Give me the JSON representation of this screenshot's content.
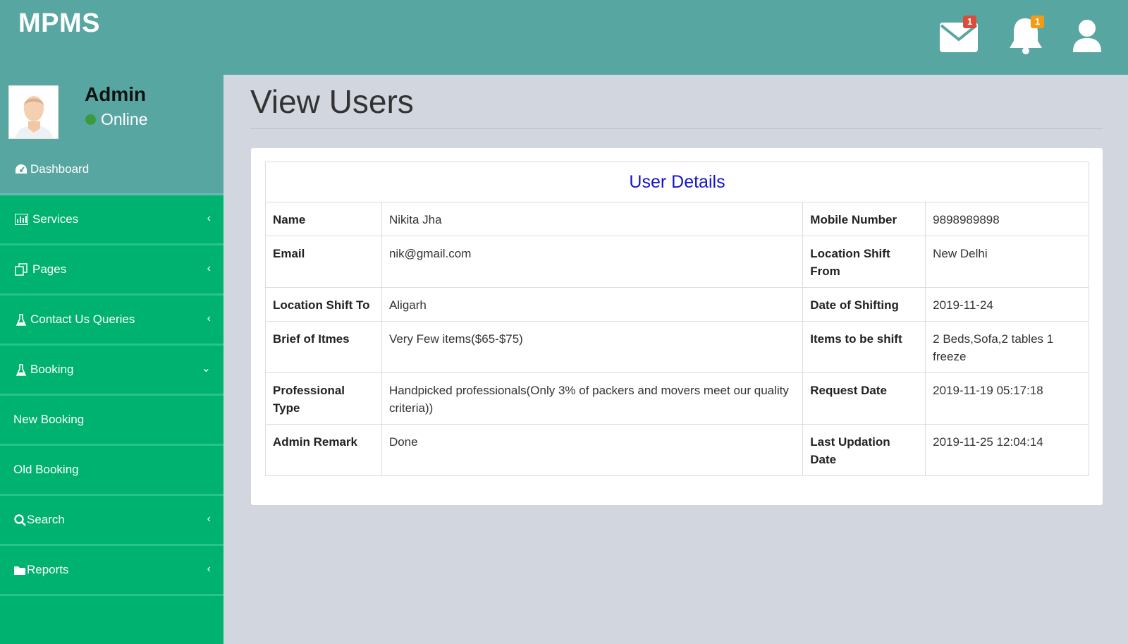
{
  "header": {
    "brand": "MPMS",
    "mail_badge": "1",
    "bell_badge": "1",
    "colors": {
      "bar": "#58a6a2",
      "mail_badge": "#dd4b39",
      "bell_badge": "#f39c12"
    }
  },
  "sidebar": {
    "user": {
      "name": "Admin",
      "status": "Online"
    },
    "items": [
      {
        "label": "Dashboard",
        "icon": "dashboard-icon"
      },
      {
        "label": "Services",
        "icon": "bar-chart-icon"
      },
      {
        "label": "Pages",
        "icon": "copy-icon"
      },
      {
        "label": "Contact Us Queries",
        "icon": "flask-icon"
      },
      {
        "label": "Booking",
        "icon": "flask-icon"
      },
      {
        "label": "New Booking"
      },
      {
        "label": "Old Booking"
      },
      {
        "label": "Search",
        "icon": "search-icon"
      },
      {
        "label": "Reports",
        "icon": "folder-icon"
      }
    ],
    "colors": {
      "background": "#00b26f",
      "active": "#58a6a2"
    }
  },
  "main": {
    "title": "View Users",
    "table": {
      "caption": "User Details",
      "rows": [
        {
          "l1": "Name",
          "v1": "Nikita Jha",
          "l2": "Mobile Number",
          "v2": "9898989898"
        },
        {
          "l1": "Email",
          "v1": "nik@gmail.com",
          "l2": "Location Shift From",
          "v2": "New Delhi"
        },
        {
          "l1": "Location Shift To",
          "v1": "Aligarh",
          "l2": "Date of Shifting",
          "v2": "2019-11-24"
        },
        {
          "l1": "Brief of Itmes",
          "v1": "Very Few items($65-$75)",
          "l2": "Items to be shift",
          "v2": "2 Beds,Sofa,2 tables 1 freeze"
        },
        {
          "l1": "Professional Type",
          "v1": "Handpicked professionals(Only 3% of packers and movers meet our quality criteria))",
          "l2": "Request Date",
          "v2": "2019-11-19 05:17:18"
        },
        {
          "l1": "Admin Remark",
          "v1": "Done",
          "l2": "Last Updation Date",
          "v2": "2019-11-25 12:04:14"
        }
      ]
    }
  }
}
